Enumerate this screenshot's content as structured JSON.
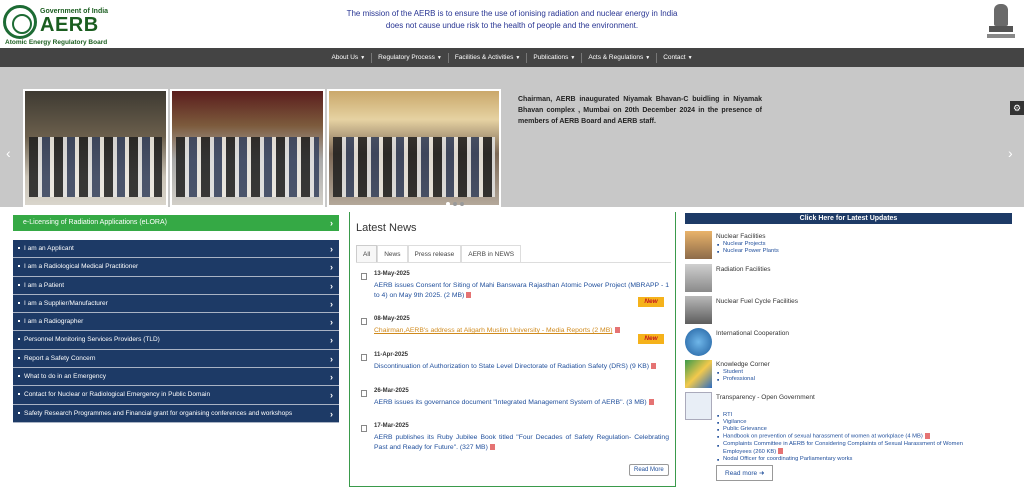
{
  "header": {
    "gov": "Government of India",
    "org_short": "AERB",
    "org_full": "Atomic Energy Regulatory Board",
    "mission_line1": "The mission of the AERB is to ensure the use of ionising radiation and nuclear energy in India",
    "mission_line2": "does not cause undue risk to the health of people and the environment."
  },
  "nav": [
    {
      "label": "About Us"
    },
    {
      "label": "Regulatory Process"
    },
    {
      "label": "Facilities & Activities"
    },
    {
      "label": "Publications"
    },
    {
      "label": "Acts & Regulations"
    },
    {
      "label": "Contact"
    }
  ],
  "banner": {
    "caption": "Chairman, AERB inaugurated Niyamak Bhavan-C buidling in Niyamak Bhavan complex , Mumbai on 20th December 2024 in the presence of members of AERB Board and AERB staff."
  },
  "left": {
    "elicense": "e-Licensing of Radiation Applications (eLORA)",
    "items": [
      "I am an Applicant",
      "I am a Radiological Medical Practitioner",
      "I am a Patient",
      "I am a Supplier/Manufacturer",
      "I am a Radiographer",
      "Personnel Monitoring Services Providers (TLD)",
      "Report a Safety Concern",
      "What to do in an Emergency",
      "Contact for Nuclear or Radiological Emergency in Public Domain",
      "Safety Research Programmes and Financial grant for organising conferences and workshops"
    ]
  },
  "news": {
    "title": "Latest News",
    "tabs": [
      "All",
      "News",
      "Press release",
      "AERB in NEWS"
    ],
    "items": [
      {
        "date": "13-May-2025",
        "text": "AERB issues Consent for Siting of Mahi Banswara Rajasthan Atomic Power Project (MBRAPP - 1 to 4) on May 9th 2025. (2 MB)",
        "new": true
      },
      {
        "date": "08-May-2025",
        "text": "Chairman,AERB's address at Aligarh Muslim University - Media Reports (2 MB)",
        "new": true
      },
      {
        "date": "11-Apr-2025",
        "text": "Discontinuation of Authorization to State Level Directorate of Radiation Safety (DRS) (9 KB)",
        "new": false
      },
      {
        "date": "26-Mar-2025",
        "text": "AERB issues its governance document \"Integrated Management System of AERB\". (3 MB)",
        "new": false
      },
      {
        "date": "17-Mar-2025",
        "text": "AERB publishes its Ruby Jubilee Book titled \"Four Decades of Safety Regulation- Celebrating Past and Ready for Future\". (327 MB)",
        "new": false
      }
    ],
    "new_label": "New",
    "read_more": "Read More"
  },
  "right": {
    "header": "Click Here for Latest Updates",
    "nuclear_facilities": "Nuclear Facilities",
    "nuclear_projects": "Nuclear Projects",
    "nuclear_power_plants": "Nuclear Power Plants",
    "radiation_facilities": "Radiation Facilities",
    "fuel_cycle": "Nuclear Fuel Cycle Facilities",
    "international": "International Cooperation",
    "knowledge": "Knowledge Corner",
    "student": "Student",
    "professional": "Professional",
    "transparency": "Transparency - Open Government",
    "rti": "RTI",
    "vigilance": "Vigilance",
    "grievance": "Public Grievance",
    "handbook": "Handbook on prevention of sexual harassment of women at workplace (4 MB)",
    "complaints": "Complaints Committee in AERB for Considering Complaints of Sexual Harassment of Women Employees (260 KB)",
    "nodal": "Nodal Officer for coordinating Parliamentary works",
    "read_more": "Read more"
  },
  "icons": [
    "settings-gear-icon",
    "chevron-left-icon",
    "chevron-right-icon",
    "pdf-icon",
    "news-doc-icon"
  ],
  "colors": {
    "brand_green": "#1b5e20",
    "nav_dark": "#444444",
    "navy": "#1d3a66",
    "elora_green": "#35a945",
    "link_blue": "#1f4e9b",
    "new_badge": "#f5b21b"
  }
}
